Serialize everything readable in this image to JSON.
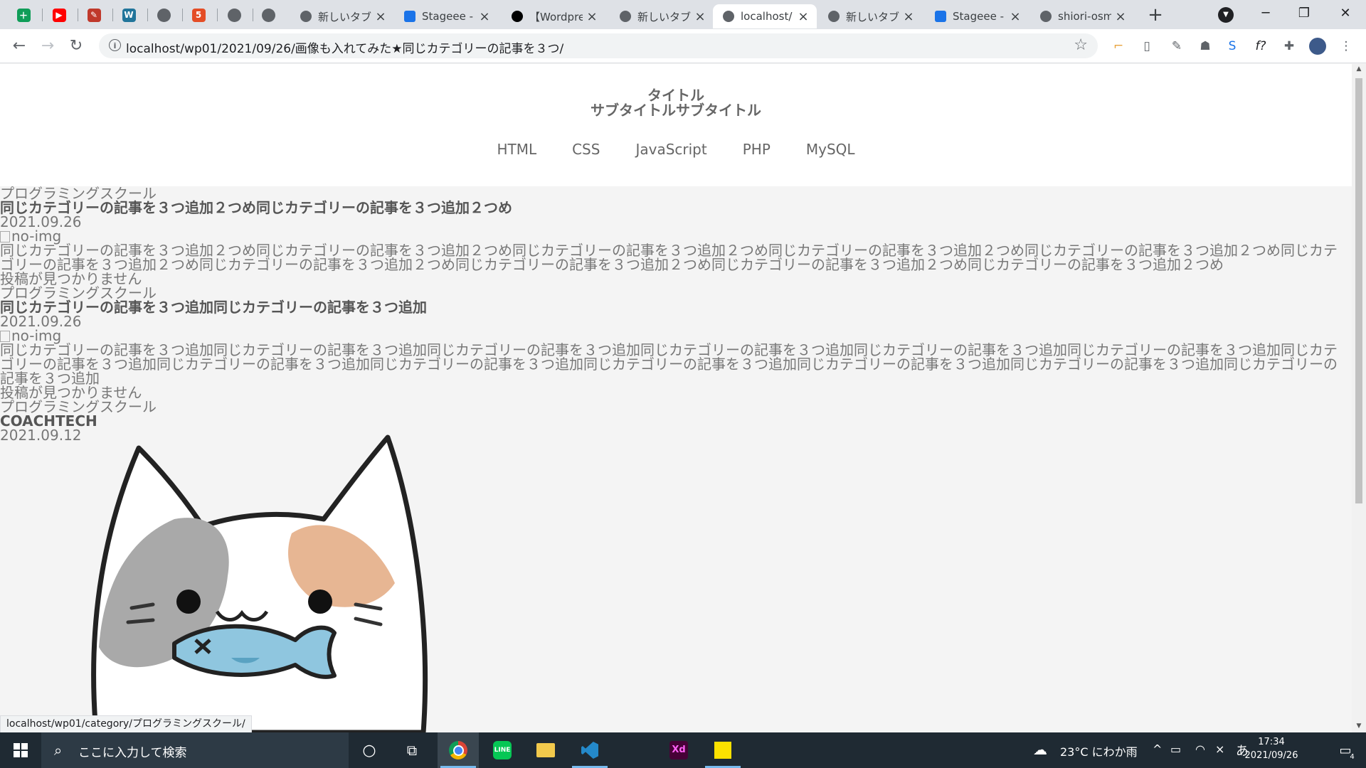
{
  "browser": {
    "pinned_tabs": [
      {
        "name": "sheets-icon",
        "color": "#0f9d58",
        "glyph": "＋"
      },
      {
        "name": "youtube-icon",
        "color": "#ff0000",
        "glyph": "▶"
      },
      {
        "name": "app-icon",
        "color": "#c0392b",
        "glyph": "✎"
      },
      {
        "name": "wordpress-icon",
        "color": "#21759b",
        "glyph": "W"
      },
      {
        "name": "globe-icon",
        "color": "#5f6368",
        "glyph": ""
      },
      {
        "name": "html-icon",
        "color": "#e44d26",
        "glyph": "5"
      },
      {
        "name": "globe-icon",
        "color": "#5f6368",
        "glyph": ""
      },
      {
        "name": "globe-icon",
        "color": "#5f6368",
        "glyph": ""
      }
    ],
    "tabs": [
      {
        "title": "新しいタブ",
        "icon": "chrome-icon"
      },
      {
        "title": "Stageee -",
        "icon": "stageee-icon"
      },
      {
        "title": "【Wordpre",
        "icon": "medium-icon"
      },
      {
        "title": "新しいタブ",
        "icon": "chrome-icon"
      },
      {
        "title": "localhost/",
        "icon": "globe-icon",
        "active": true
      },
      {
        "title": "新しいタブ",
        "icon": "chrome-icon"
      },
      {
        "title": "Stageee -",
        "icon": "stageee-icon"
      },
      {
        "title": "shiori-osm",
        "icon": "github-icon"
      }
    ],
    "url": "localhost/wp01/2021/09/26/画像も入れてみた★同じカテゴリーの記事を３つ/",
    "status_url": "localhost/wp01/category/プログラミングスクール/"
  },
  "site": {
    "title": "タイトル",
    "subtitle": "サブタイトルサブタイトル",
    "nav": [
      "HTML",
      "CSS",
      "JavaScript",
      "PHP",
      "MySQL"
    ]
  },
  "posts": [
    {
      "category": "プログラミングスクール",
      "title": "同じカテゴリーの記事を３つ追加２つめ同じカテゴリーの記事を３つ追加２つめ",
      "date": "2021.09.26",
      "img_alt": "no-img",
      "excerpt": "同じカテゴリーの記事を３つ追加２つめ同じカテゴリーの記事を３つ追加２つめ同じカテゴリーの記事を３つ追加２つめ同じカテゴリーの記事を３つ追加２つめ同じカテゴリーの記事を３つ追加２つめ同じカテゴリーの記事を３つ追加２つめ同じカテゴリーの記事を３つ追加２つめ同じカテゴリーの記事を３つ追加２つめ同じカテゴリーの記事を３つ追加２つめ同じカテゴリーの記事を３つ追加２つめ",
      "not_found": "投稿が見つかりません"
    },
    {
      "category": "プログラミングスクール",
      "title": "同じカテゴリーの記事を３つ追加同じカテゴリーの記事を３つ追加",
      "date": "2021.09.26",
      "img_alt": "no-img",
      "excerpt": "同じカテゴリーの記事を３つ追加同じカテゴリーの記事を３つ追加同じカテゴリーの記事を３つ追加同じカテゴリーの記事を３つ追加同じカテゴリーの記事を３つ追加同じカテゴリーの記事を３つ追加同じカテゴリーの記事を３つ追加同じカテゴリーの記事を３つ追加同じカテゴリーの記事を３つ追加同じカテゴリーの記事を３つ追加同じカテゴリーの記事を３つ追加同じカテゴリーの記事を３つ追加同じカテゴリーの記事を３つ追加",
      "not_found": "投稿が見つかりません"
    },
    {
      "category": "プログラミングスクール",
      "title": "COACHTECH",
      "date": "2021.09.12"
    }
  ],
  "taskbar": {
    "search_placeholder": "ここに入力して検索",
    "weather": "23°C にわか雨",
    "ime": "あ",
    "time": "17:34",
    "date": "2021/09/26",
    "notifications": "4"
  }
}
